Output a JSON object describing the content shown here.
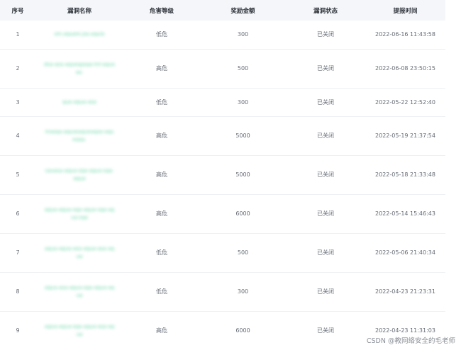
{
  "table": {
    "headers": [
      "序号",
      "漏洞名称",
      "危害等级",
      "奖励金额",
      "漏洞状态",
      "提报时间"
    ],
    "rows": [
      {
        "index": "1",
        "name": "sm.aquare.jsa.aquia",
        "level": "低危",
        "reward": "300",
        "status": "已关闭",
        "time": "2022-06-16 11:43:58"
      },
      {
        "index": "2",
        "name": "dsa-asa-aqueapsqa-tnl-aquaaa.",
        "level": "高危",
        "reward": "500",
        "status": "已关闭",
        "time": "2022-06-08 23:50:15"
      },
      {
        "index": "3",
        "name": "qua-aqua-asa",
        "level": "低危",
        "reward": "300",
        "status": "已关闭",
        "time": "2022-05-22 12:52:40"
      },
      {
        "index": "4",
        "name": "masqa-aquasaqueaqsa-aqueaaa.",
        "level": "高危",
        "reward": "5000",
        "status": "已关闭",
        "time": "2022-05-19 21:37:54"
      },
      {
        "index": "5",
        "name": "sauasa-aqua-sqa-aqua-sqa-aqua",
        "level": "高危",
        "reward": "5000",
        "status": "已关闭",
        "time": "2022-05-18 21:33:48"
      },
      {
        "index": "6",
        "name": "aqua-aqua-sqa-aqua-sqa-aqua-sqa",
        "level": "高危",
        "reward": "6000",
        "status": "已关闭",
        "time": "2022-05-14 15:46:43"
      },
      {
        "index": "7",
        "name": "aqua-aqua-asa-aqua-asa-aqua",
        "level": "低危",
        "reward": "500",
        "status": "已关闭",
        "time": "2022-05-06 21:40:34"
      },
      {
        "index": "8",
        "name": "aqua-asa-aqua-sqa-aqua-aqua",
        "level": "低危",
        "reward": "300",
        "status": "已关闭",
        "time": "2022-04-23 21:23:31"
      },
      {
        "index": "9",
        "name": "aqua-aqua-sqa-aqua-asa-aqua",
        "level": "高危",
        "reward": "6000",
        "status": "已关闭",
        "time": "2022-04-23 11:31:03"
      }
    ]
  },
  "watermark": "CSDN @教网络安全的毛老师"
}
